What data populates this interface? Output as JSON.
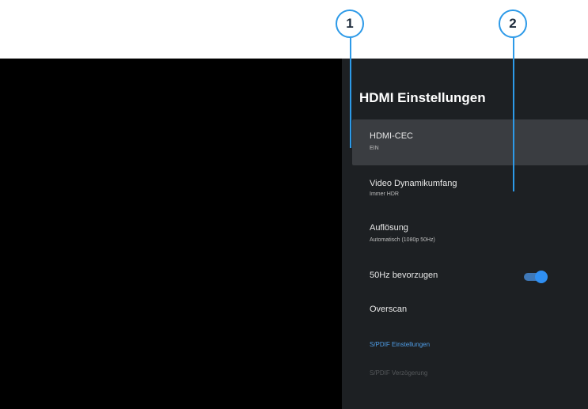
{
  "callouts": [
    "1",
    "2"
  ],
  "panel": {
    "title": "HDMI Einstellungen",
    "items": [
      {
        "label": "HDMI-CEC",
        "value": "EIN"
      },
      {
        "label": "Video Dynamikumfang",
        "value": "Immer HDR"
      },
      {
        "label": "Auflösung",
        "value": "Automatisch (1080p 50Hz)"
      },
      {
        "label": "50Hz bevorzugen",
        "toggle": "on"
      },
      {
        "label": "Overscan"
      },
      {
        "label": "S/PDIF Einstellungen"
      },
      {
        "label": "S/PDIF Verzögerung"
      }
    ]
  },
  "colors": {
    "accent": "#2d9ae8",
    "panel_bg": "#1d2023",
    "focused_bg": "#3a3d41",
    "link": "#4f9ee8",
    "toggle_on": "#2f8ff2"
  },
  "icons": {
    "toggle": "toggle-switch-icon"
  }
}
